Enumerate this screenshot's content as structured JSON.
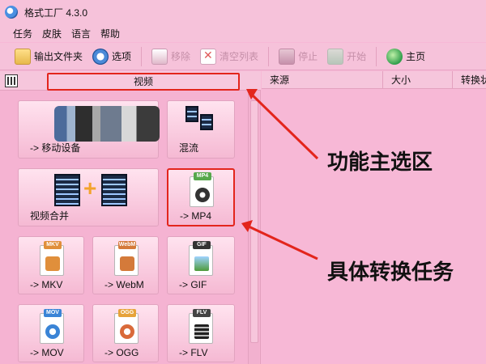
{
  "app": {
    "title": "格式工厂 4.3.0"
  },
  "menu": {
    "items": [
      "任务",
      "皮肤",
      "语言",
      "帮助"
    ]
  },
  "toolbar": {
    "output_folder": "输出文件夹",
    "options": "选项",
    "remove": "移除",
    "clear_list": "清空列表",
    "stop": "停止",
    "start": "开始",
    "home": "主页"
  },
  "category": {
    "active_label": "视频"
  },
  "tiles": {
    "mobile": "-> 移动设备",
    "mix": "混流",
    "merge": "视频合并",
    "mp4": "-> MP4",
    "mkv": "-> MKV",
    "webm": "-> WebM",
    "gif": "-> GIF",
    "mov": "-> MOV",
    "ogg": "-> OGG",
    "flv": "-> FLV"
  },
  "tile_icons": {
    "mp4": "MP4",
    "mkv": "MKV",
    "webm": "WebM",
    "gif": "GIF",
    "mov": "MOV",
    "ogg": "OGG",
    "flv": "FLV"
  },
  "task_list": {
    "columns": [
      "来源",
      "大小",
      "转换状"
    ]
  },
  "annotations": {
    "function_area": "功能主选区",
    "task_area": "具体转换任务"
  },
  "colors": {
    "highlight": "#e3251c",
    "background": "#f7b8d6"
  }
}
